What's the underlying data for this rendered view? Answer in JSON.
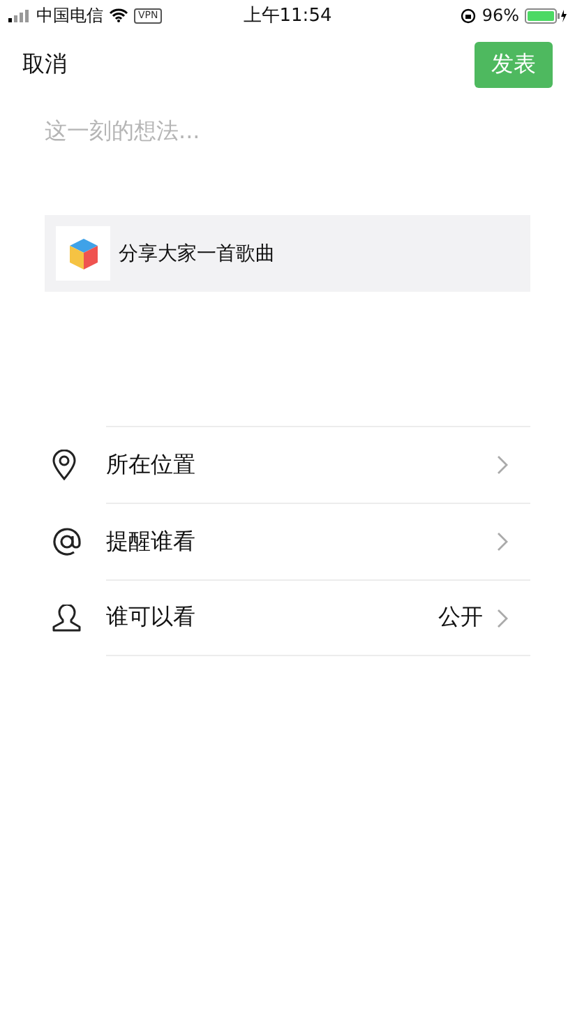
{
  "status_bar": {
    "carrier": "中国电信",
    "vpn": "VPN",
    "time": "上午11:54",
    "battery": "96%"
  },
  "nav": {
    "cancel": "取消",
    "publish": "发表"
  },
  "composer": {
    "placeholder": "这一刻的想法..."
  },
  "share_card": {
    "title": "分享大家一首歌曲"
  },
  "options": [
    {
      "kind": "location",
      "label": "所在位置"
    },
    {
      "kind": "mention",
      "label": "提醒谁看"
    },
    {
      "kind": "visibility",
      "label": "谁可以看",
      "value": "公开"
    }
  ]
}
